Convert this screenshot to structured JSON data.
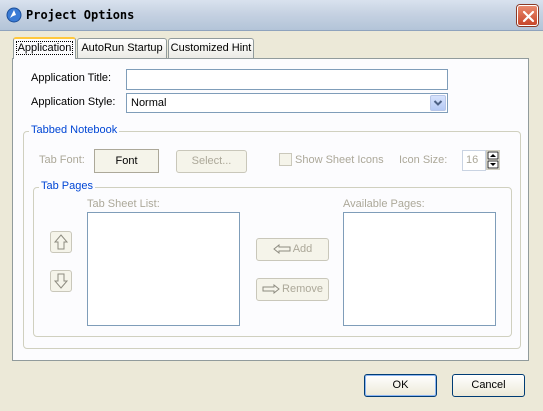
{
  "window": {
    "title": "Project Options"
  },
  "tabs": [
    {
      "label": "Application"
    },
    {
      "label": "AutoRun Startup"
    },
    {
      "label": "Customized Hint"
    }
  ],
  "form": {
    "app_title_label": "Application Title:",
    "app_title_value": "",
    "app_style_label": "Application Style:",
    "app_style_value": "Normal"
  },
  "tabbed_notebook": {
    "title": "Tabbed Notebook",
    "tab_font_label": "Tab Font:",
    "font_button": "Font",
    "select_button": "Select...",
    "show_sheet_icons_label": "Show Sheet Icons",
    "show_sheet_icons_checked": false,
    "icon_size_label": "Icon Size:",
    "icon_size_value": "16"
  },
  "tab_pages": {
    "title": "Tab Pages",
    "tab_sheet_list_label": "Tab Sheet List:",
    "available_pages_label": "Available Pages:",
    "add_button": "Add",
    "remove_button": "Remove",
    "tab_sheet_items": [],
    "available_items": []
  },
  "footer": {
    "ok_button": "OK",
    "cancel_button": "Cancel"
  },
  "colors": {
    "dialog_bg": "#ece9d8",
    "group_title": "#0046d5",
    "disabled_text": "#aca899",
    "tab_highlight": "#ffc83c"
  }
}
